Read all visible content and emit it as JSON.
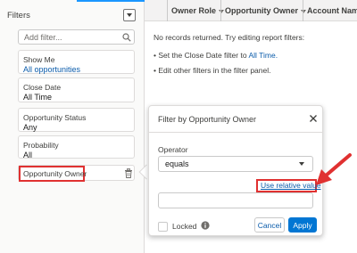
{
  "filters_panel": {
    "title": "Filters",
    "search": {
      "placeholder": "Add filter...",
      "value": ""
    },
    "filters": [
      {
        "label": "Show Me",
        "value": "All opportunities"
      },
      {
        "label": "Close Date",
        "value": "All Time"
      },
      {
        "label": "Opportunity Status",
        "value": "Any"
      },
      {
        "label": "Probability",
        "value": "All"
      }
    ],
    "new_filter_label": "Opportunity Owner"
  },
  "report": {
    "columns": [
      "Owner Role",
      "Opportunity Owner",
      "Account Name"
    ],
    "messages": {
      "no_records": "No records returned. Try editing report filters:",
      "close_date_prefix": "• Set the Close Date filter to",
      "close_date_link": "All Time.",
      "edit_other": "• Edit other filters in the filter panel."
    }
  },
  "dialog": {
    "title": "Filter by Opportunity Owner",
    "operator_label": "Operator",
    "operator_value": "equals",
    "relative_link": "Use relative value",
    "value_input": "",
    "locked_label": "Locked",
    "locked_checked": false,
    "cancel_label": "Cancel",
    "apply_label": "Apply"
  },
  "colors": {
    "accent_blue": "#0176d3",
    "link_blue": "#0b5cab",
    "annotation_red": "#e03131"
  },
  "icons": [
    "search-icon",
    "chevron-down-icon",
    "trash-icon",
    "close-icon",
    "info-icon",
    "arrow-annotation"
  ]
}
